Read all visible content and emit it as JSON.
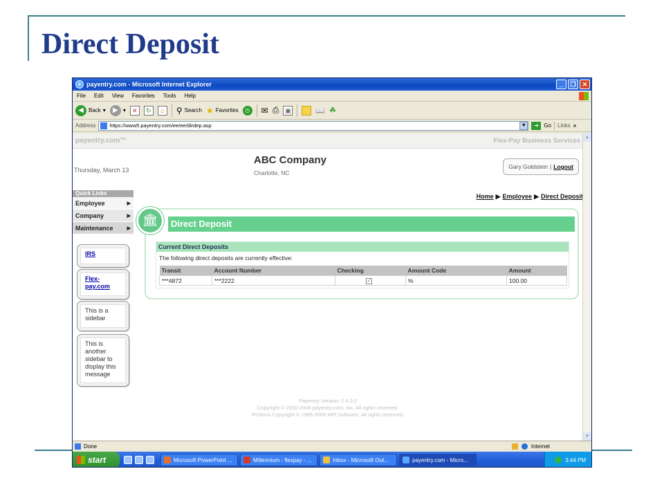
{
  "slide": {
    "title": "Direct Deposit"
  },
  "browser": {
    "window_title": "payentry.com - Microsoft Internet Explorer",
    "menu": [
      "File",
      "Edit",
      "View",
      "Favorites",
      "Tools",
      "Help"
    ],
    "toolbar": {
      "back": "Back",
      "search": "Search",
      "favorites": "Favorites"
    },
    "address_label": "Address",
    "url": "https://www5.payentry.com/ee/ee/dirdep.asp",
    "go_label": "Go",
    "links_label": "Links",
    "status_left": "Done",
    "status_zone": "Internet"
  },
  "site": {
    "logo": "payentry.com™",
    "service": "Flex-Pay Business Services",
    "date": "Thursday, March 13",
    "company_name": "ABC Company",
    "company_location": "Charlotte, NC",
    "user_name": "Gary Goldstein",
    "separator": "|",
    "logout": "Logout"
  },
  "quick_links": {
    "header": "Quick Links",
    "items": [
      {
        "label": "Employee"
      },
      {
        "label": "Company"
      },
      {
        "label": "Maintenance"
      }
    ]
  },
  "sidebars": [
    {
      "text": "IRS"
    },
    {
      "text": "Flex-pay.com"
    },
    {
      "text": "This is a sidebar"
    },
    {
      "text": "This is another sidebar to display this message"
    }
  ],
  "breadcrumb": {
    "home": "Home",
    "employee": "Employee",
    "current": "Direct Deposit"
  },
  "panel": {
    "title": "Direct Deposit",
    "section_title": "Current Direct Deposits",
    "description": "The following direct deposits are currently effective:",
    "columns": [
      "Transit",
      "Account Number",
      "Checking",
      "Amount Code",
      "Amount"
    ],
    "rows": [
      {
        "transit": "***4872",
        "account": "***2222",
        "checking": true,
        "amount_code": "%",
        "amount": "100.00"
      }
    ]
  },
  "footer": {
    "version": "Payentry Version: 2.4.0.0",
    "copyright1": "Copyright © 2000-2008 payentry.com, Inc. All rights reserved.",
    "copyright2": "Portions Copyright © 1995-2008 MPI Software. All rights reserved."
  },
  "taskbar": {
    "start": "start",
    "tasks": [
      {
        "label": "Microsoft PowerPoint ...",
        "color": "#e8702a"
      },
      {
        "label": "Millennium - flexpay - ...",
        "color": "#d43a2a"
      },
      {
        "label": "Inbox - Microsoft Out...",
        "color": "#f0c040"
      },
      {
        "label": "payentry.com - Micro...",
        "color": "#5aa7ff"
      }
    ],
    "clock": "3:44 PM"
  }
}
